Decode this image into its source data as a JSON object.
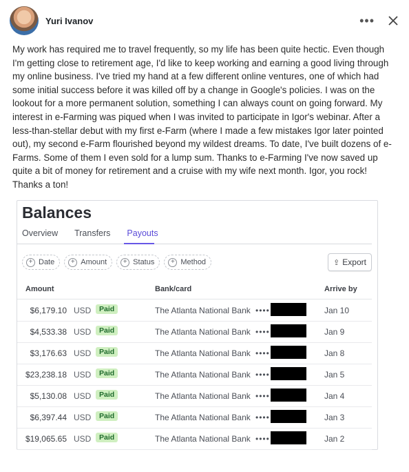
{
  "post": {
    "author": "Yuri Ivanov",
    "text": "My work has required me to travel frequently, so my life has been quite hectic. Even though I'm getting close to retirement age, I'd like to keep working and earning a good living through my online business. I've tried my hand at a few different online ventures, one of which had some initial success before it was killed off by a change in Google's policies. I was on the lookout for a more permanent solution, something I can always count on going forward. My interest in e-Farming was piqued when I was invited to participate in Igor's webinar. After a less-than-stellar debut with my first e-Farm (where I made a few mistakes Igor later pointed out), my second e-Farm flourished beyond my wildest dreams. To date, I've built dozens of e-Farms. Some of them I even sold for a lump sum. Thanks to e-Farming I've now saved up quite a bit of money  for retirement and a cruise with my wife next month. Igor, you rock! Thanks a ton!",
    "more_icon": "more-horizontal-icon",
    "close_icon": "close-icon"
  },
  "balances": {
    "title": "Balances",
    "tabs": [
      "Overview",
      "Transfers",
      "Payouts"
    ],
    "active_tab": "Payouts",
    "filters": [
      "Date",
      "Amount",
      "Status",
      "Method"
    ],
    "export_label": "Export",
    "columns": {
      "amount": "Amount",
      "bank": "Bank/card",
      "arrive": "Arrive by"
    },
    "rows": [
      {
        "amount": "$6,179.10",
        "currency": "USD",
        "status": "Paid",
        "bank": "The Atlanta National Bank",
        "mask": "••••",
        "arrive": "Jan 10"
      },
      {
        "amount": "$4,533.38",
        "currency": "USD",
        "status": "Paid",
        "bank": "The Atlanta National Bank",
        "mask": "••••",
        "arrive": "Jan 9"
      },
      {
        "amount": "$3,176.63",
        "currency": "USD",
        "status": "Paid",
        "bank": "The Atlanta National Bank",
        "mask": "••••",
        "arrive": "Jan 8"
      },
      {
        "amount": "$23,238.18",
        "currency": "USD",
        "status": "Paid",
        "bank": "The Atlanta National Bank",
        "mask": "••••",
        "arrive": "Jan 5"
      },
      {
        "amount": "$5,130.08",
        "currency": "USD",
        "status": "Paid",
        "bank": "The Atlanta National Bank",
        "mask": "••••",
        "arrive": "Jan 4"
      },
      {
        "amount": "$6,397.44",
        "currency": "USD",
        "status": "Paid",
        "bank": "The Atlanta National Bank",
        "mask": "••••",
        "arrive": "Jan 3"
      },
      {
        "amount": "$19,065.65",
        "currency": "USD",
        "status": "Paid",
        "bank": "The Atlanta National Bank",
        "mask": "••••",
        "arrive": "Jan 2"
      }
    ],
    "colors": {
      "accent": "#6657e6",
      "paid_bg": "#cfefc0",
      "paid_text": "#1f6b2c"
    }
  }
}
